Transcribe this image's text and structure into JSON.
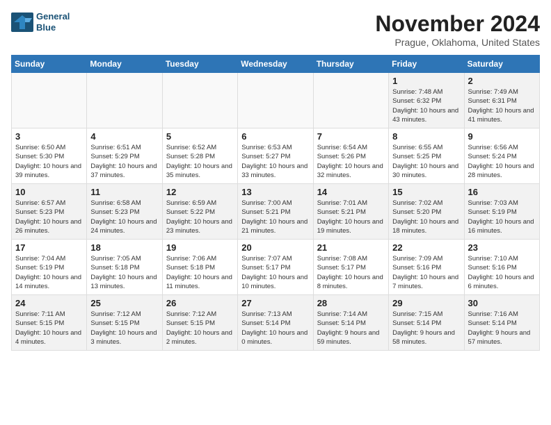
{
  "header": {
    "logo_line1": "General",
    "logo_line2": "Blue",
    "month": "November 2024",
    "location": "Prague, Oklahoma, United States"
  },
  "weekdays": [
    "Sunday",
    "Monday",
    "Tuesday",
    "Wednesday",
    "Thursday",
    "Friday",
    "Saturday"
  ],
  "weeks": [
    [
      {
        "day": "",
        "info": ""
      },
      {
        "day": "",
        "info": ""
      },
      {
        "day": "",
        "info": ""
      },
      {
        "day": "",
        "info": ""
      },
      {
        "day": "",
        "info": ""
      },
      {
        "day": "1",
        "info": "Sunrise: 7:48 AM\nSunset: 6:32 PM\nDaylight: 10 hours and 43 minutes."
      },
      {
        "day": "2",
        "info": "Sunrise: 7:49 AM\nSunset: 6:31 PM\nDaylight: 10 hours and 41 minutes."
      }
    ],
    [
      {
        "day": "3",
        "info": "Sunrise: 6:50 AM\nSunset: 5:30 PM\nDaylight: 10 hours and 39 minutes."
      },
      {
        "day": "4",
        "info": "Sunrise: 6:51 AM\nSunset: 5:29 PM\nDaylight: 10 hours and 37 minutes."
      },
      {
        "day": "5",
        "info": "Sunrise: 6:52 AM\nSunset: 5:28 PM\nDaylight: 10 hours and 35 minutes."
      },
      {
        "day": "6",
        "info": "Sunrise: 6:53 AM\nSunset: 5:27 PM\nDaylight: 10 hours and 33 minutes."
      },
      {
        "day": "7",
        "info": "Sunrise: 6:54 AM\nSunset: 5:26 PM\nDaylight: 10 hours and 32 minutes."
      },
      {
        "day": "8",
        "info": "Sunrise: 6:55 AM\nSunset: 5:25 PM\nDaylight: 10 hours and 30 minutes."
      },
      {
        "day": "9",
        "info": "Sunrise: 6:56 AM\nSunset: 5:24 PM\nDaylight: 10 hours and 28 minutes."
      }
    ],
    [
      {
        "day": "10",
        "info": "Sunrise: 6:57 AM\nSunset: 5:23 PM\nDaylight: 10 hours and 26 minutes."
      },
      {
        "day": "11",
        "info": "Sunrise: 6:58 AM\nSunset: 5:23 PM\nDaylight: 10 hours and 24 minutes."
      },
      {
        "day": "12",
        "info": "Sunrise: 6:59 AM\nSunset: 5:22 PM\nDaylight: 10 hours and 23 minutes."
      },
      {
        "day": "13",
        "info": "Sunrise: 7:00 AM\nSunset: 5:21 PM\nDaylight: 10 hours and 21 minutes."
      },
      {
        "day": "14",
        "info": "Sunrise: 7:01 AM\nSunset: 5:21 PM\nDaylight: 10 hours and 19 minutes."
      },
      {
        "day": "15",
        "info": "Sunrise: 7:02 AM\nSunset: 5:20 PM\nDaylight: 10 hours and 18 minutes."
      },
      {
        "day": "16",
        "info": "Sunrise: 7:03 AM\nSunset: 5:19 PM\nDaylight: 10 hours and 16 minutes."
      }
    ],
    [
      {
        "day": "17",
        "info": "Sunrise: 7:04 AM\nSunset: 5:19 PM\nDaylight: 10 hours and 14 minutes."
      },
      {
        "day": "18",
        "info": "Sunrise: 7:05 AM\nSunset: 5:18 PM\nDaylight: 10 hours and 13 minutes."
      },
      {
        "day": "19",
        "info": "Sunrise: 7:06 AM\nSunset: 5:18 PM\nDaylight: 10 hours and 11 minutes."
      },
      {
        "day": "20",
        "info": "Sunrise: 7:07 AM\nSunset: 5:17 PM\nDaylight: 10 hours and 10 minutes."
      },
      {
        "day": "21",
        "info": "Sunrise: 7:08 AM\nSunset: 5:17 PM\nDaylight: 10 hours and 8 minutes."
      },
      {
        "day": "22",
        "info": "Sunrise: 7:09 AM\nSunset: 5:16 PM\nDaylight: 10 hours and 7 minutes."
      },
      {
        "day": "23",
        "info": "Sunrise: 7:10 AM\nSunset: 5:16 PM\nDaylight: 10 hours and 6 minutes."
      }
    ],
    [
      {
        "day": "24",
        "info": "Sunrise: 7:11 AM\nSunset: 5:15 PM\nDaylight: 10 hours and 4 minutes."
      },
      {
        "day": "25",
        "info": "Sunrise: 7:12 AM\nSunset: 5:15 PM\nDaylight: 10 hours and 3 minutes."
      },
      {
        "day": "26",
        "info": "Sunrise: 7:12 AM\nSunset: 5:15 PM\nDaylight: 10 hours and 2 minutes."
      },
      {
        "day": "27",
        "info": "Sunrise: 7:13 AM\nSunset: 5:14 PM\nDaylight: 10 hours and 0 minutes."
      },
      {
        "day": "28",
        "info": "Sunrise: 7:14 AM\nSunset: 5:14 PM\nDaylight: 9 hours and 59 minutes."
      },
      {
        "day": "29",
        "info": "Sunrise: 7:15 AM\nSunset: 5:14 PM\nDaylight: 9 hours and 58 minutes."
      },
      {
        "day": "30",
        "info": "Sunrise: 7:16 AM\nSunset: 5:14 PM\nDaylight: 9 hours and 57 minutes."
      }
    ]
  ]
}
